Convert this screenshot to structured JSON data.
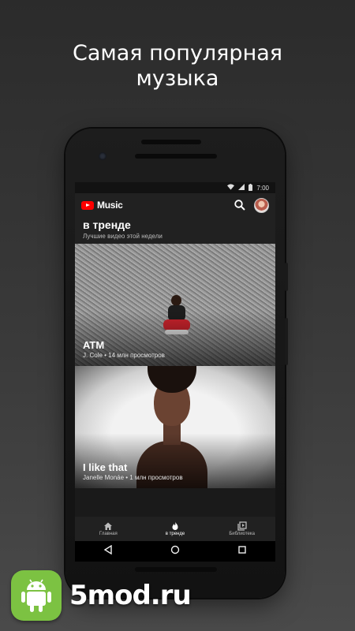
{
  "promo": {
    "title": "Самая популярная\nмузыка"
  },
  "status_bar": {
    "time": "7:00",
    "icons": [
      "wifi-icon",
      "signal-icon",
      "battery-icon"
    ]
  },
  "app_bar": {
    "brand": "Music",
    "icons": [
      "youtube-logo-icon",
      "search-icon",
      "avatar"
    ]
  },
  "section": {
    "title": "в тренде",
    "subtitle": "Лучшие видео этой недели"
  },
  "cards": [
    {
      "title": "ATM",
      "meta": "J. Cole • 14 млн просмотров"
    },
    {
      "title": "I like that",
      "meta": "Janelle Monáe • 1 млн просмотров"
    }
  ],
  "bottom_nav": {
    "items": [
      {
        "label": "Главная",
        "icon": "home-icon"
      },
      {
        "label": "в тренде",
        "icon": "trending-fire-icon",
        "active": true
      },
      {
        "label": "Библиотека",
        "icon": "library-icon"
      }
    ]
  },
  "system_nav": {
    "icons": [
      "back-icon",
      "home-circle-icon",
      "recents-icon"
    ]
  },
  "watermark": {
    "text": "5mod.ru",
    "icon": "android-icon"
  },
  "colors": {
    "brand_red": "#ff0000",
    "appbar": "#212121",
    "background_top": "#2b2b2b",
    "watermark_green": "#7cc242"
  }
}
